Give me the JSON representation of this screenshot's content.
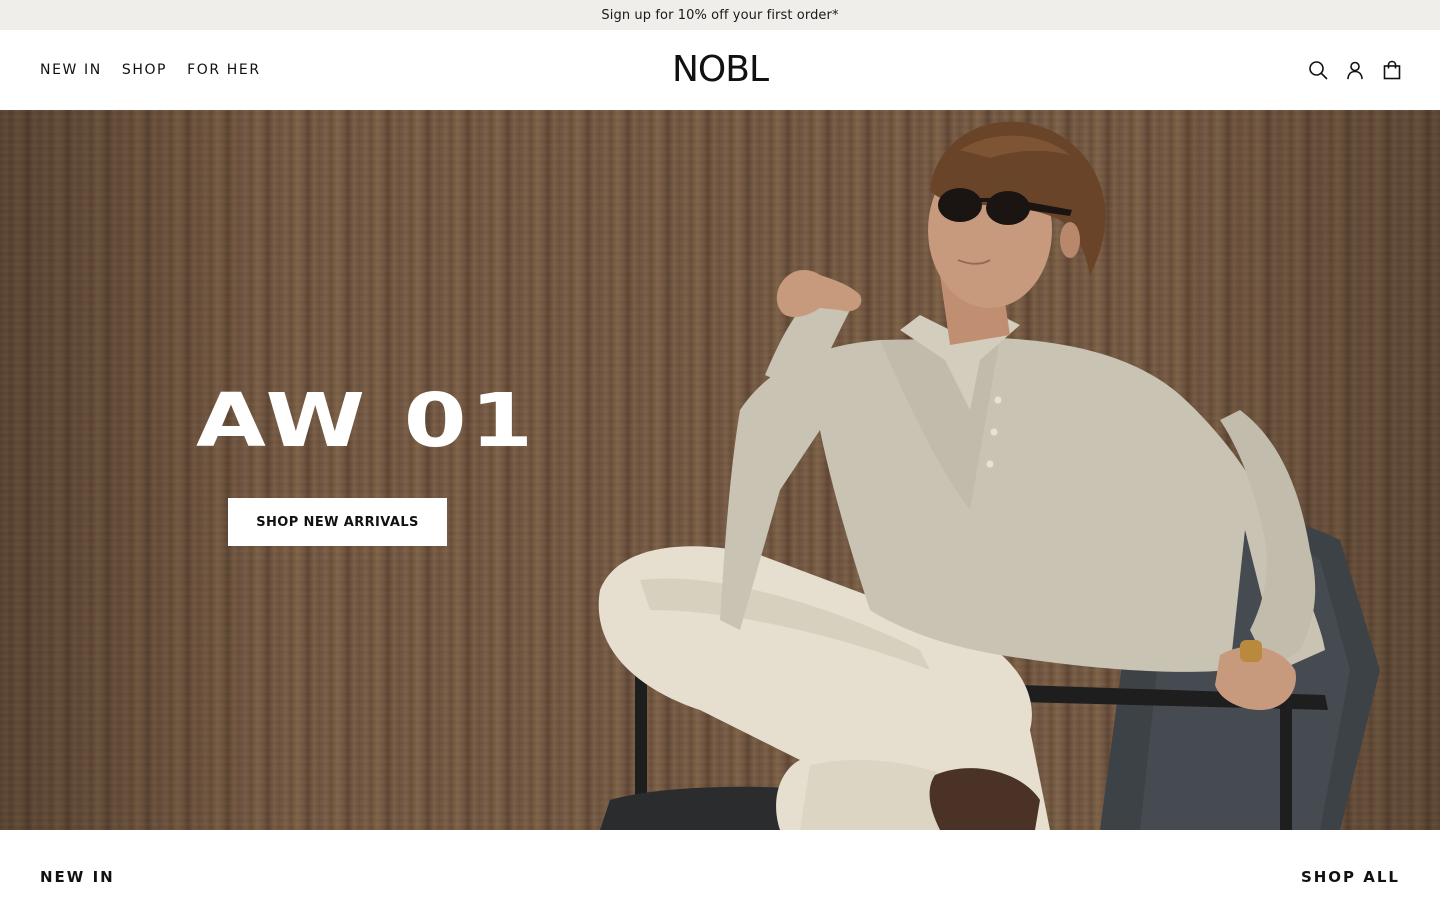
{
  "announcement": {
    "text": "Sign up for 10% off your first order*"
  },
  "header": {
    "nav": [
      {
        "label": "NEW IN"
      },
      {
        "label": "SHOP"
      },
      {
        "label": "FOR HER"
      }
    ],
    "logo": "NOBL",
    "icons": [
      "search-icon",
      "account-icon",
      "bag-icon"
    ]
  },
  "hero": {
    "title": "AW 01",
    "cta_label": "SHOP NEW ARRIVALS"
  },
  "section": {
    "title": "NEW IN",
    "link_label": "SHOP ALL"
  },
  "colors": {
    "announcement_bg": "#efeeea",
    "text": "#111111",
    "hero_wood": "#6f5540",
    "button_bg": "#ffffff"
  }
}
